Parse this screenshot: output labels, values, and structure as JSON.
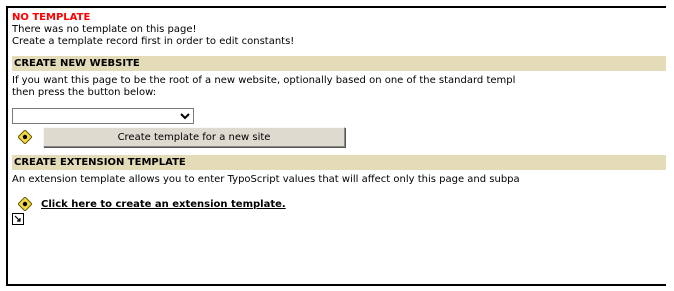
{
  "no_template": {
    "title": "NO TEMPLATE",
    "line1": "There was no template on this page!",
    "line2": "Create a template record first in order to edit constants!"
  },
  "create_website": {
    "header": "CREATE NEW WEBSITE",
    "desc1": "If you want this page to be the root of a new website, optionally based on one of the standard templ",
    "desc2": "then press the button below:",
    "select_value": "",
    "button_label": "Create template for a new site"
  },
  "extension": {
    "header": "CREATE EXTENSION TEMPLATE",
    "desc": "An extension template allows you to enter TypoScript values that will affect only this page and subpa",
    "link_label": "Click here to create an extension template."
  },
  "icons": {
    "info": "info-diamond-icon",
    "small": "new-record-icon"
  },
  "colors": {
    "error": "#ff0000",
    "section_header_bg": "#e4dcb8"
  }
}
